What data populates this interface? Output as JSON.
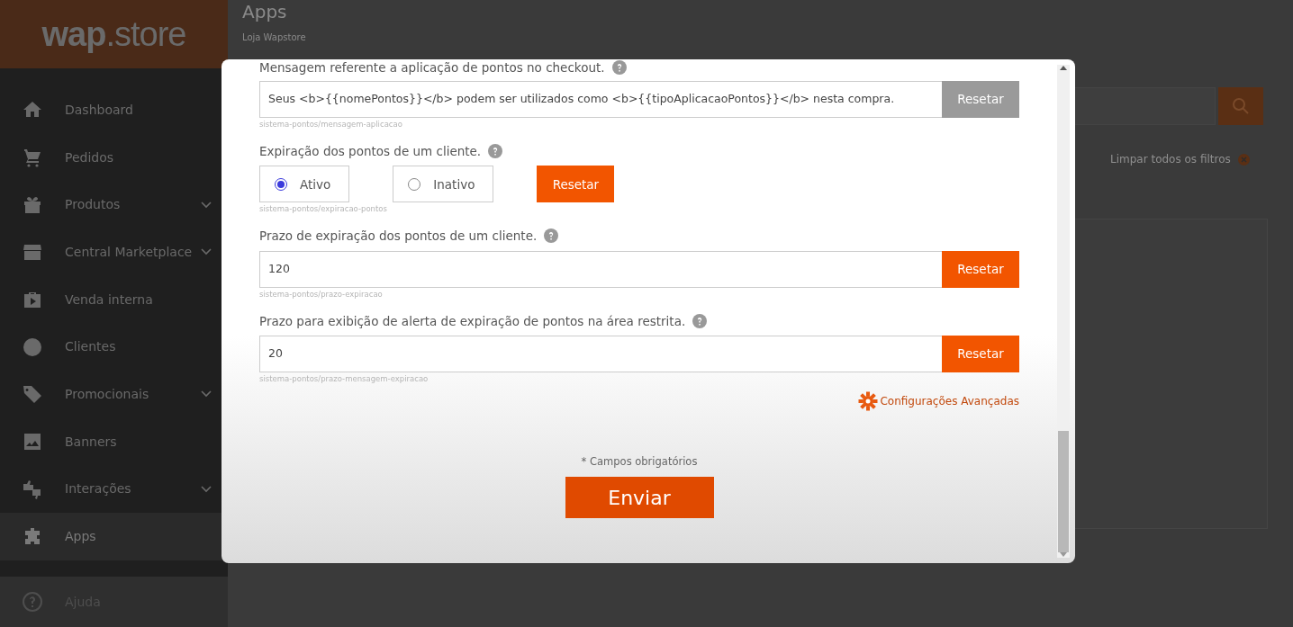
{
  "sidebar": {
    "logo": {
      "bold": "wap",
      "light": ".store"
    },
    "items": [
      {
        "label": "Dashboard",
        "has_submenu": false,
        "selected": false
      },
      {
        "label": "Pedidos",
        "has_submenu": false,
        "selected": false
      },
      {
        "label": "Produtos",
        "has_submenu": true,
        "selected": false
      },
      {
        "label": "Central Marketplace",
        "has_submenu": true,
        "selected": false
      },
      {
        "label": "Venda interna",
        "has_submenu": false,
        "selected": false
      },
      {
        "label": "Clientes",
        "has_submenu": false,
        "selected": false
      },
      {
        "label": "Promocionais",
        "has_submenu": true,
        "selected": false
      },
      {
        "label": "Banners",
        "has_submenu": false,
        "selected": false
      },
      {
        "label": "Interações",
        "has_submenu": true,
        "selected": false
      },
      {
        "label": "Apps",
        "has_submenu": false,
        "selected": true
      }
    ],
    "footer": {
      "label": "Ajuda"
    }
  },
  "page": {
    "title": "Apps",
    "breadcrumb": [
      "Loja Wapstore"
    ],
    "clear_filters": "Limpar todos os filtros"
  },
  "modal": {
    "fields": [
      {
        "kind": "text",
        "label": "Mensagem referente a aplicação de pontos no checkout.",
        "value": "Seus <b>{{nomePontos}}</b> podem ser utilizados como <b>{{tipoAplicacaoPontos}}</b> nesta compra.",
        "key": "sistema-pontos/mensagem-aplicacao",
        "reset": {
          "label": "Resetar",
          "disabled": true
        }
      },
      {
        "kind": "radio",
        "label": "Expiração dos pontos de um cliente.",
        "options": [
          {
            "label": "Ativo",
            "selected": true
          },
          {
            "label": "Inativo",
            "selected": false
          }
        ],
        "key": "sistema-pontos/expiracao-pontos",
        "reset": {
          "label": "Resetar",
          "disabled": false
        }
      },
      {
        "kind": "text",
        "label": "Prazo de expiração dos pontos de um cliente.",
        "value": "120",
        "key": "sistema-pontos/prazo-expiracao",
        "reset": {
          "label": "Resetar",
          "disabled": false
        }
      },
      {
        "kind": "text",
        "label": "Prazo para exibição de alerta de expiração de pontos na área restrita.",
        "value": "20",
        "key": "sistema-pontos/prazo-mensagem-expiracao",
        "reset": {
          "label": "Resetar",
          "disabled": false
        }
      }
    ],
    "advanced_link": "Configurações Avançadas",
    "required_note": "* Campos obrigatórios",
    "submit": "Enviar"
  }
}
